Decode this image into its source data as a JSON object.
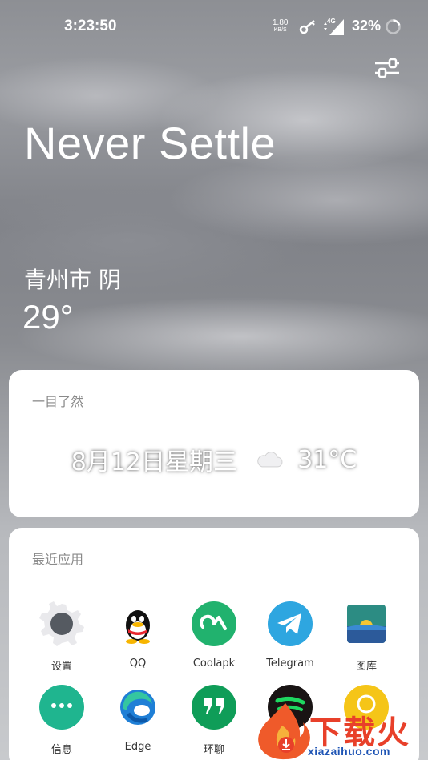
{
  "status_bar": {
    "time": "3:23:50",
    "net_speed_value": "1.80",
    "net_speed_unit": "KB/S",
    "network_type": "4G",
    "battery_percent": "32%"
  },
  "header": {
    "headline": "Never Settle"
  },
  "weather": {
    "city_condition": "青州市  阴",
    "temperature": "29°"
  },
  "glance_card": {
    "title": "一目了然",
    "date": "8月12日星期三",
    "forecast_temp": "31°C"
  },
  "recent_apps_card": {
    "title": "最近应用",
    "apps": [
      {
        "label": "设置",
        "icon": "settings-gear-icon"
      },
      {
        "label": "QQ",
        "icon": "qq-penguin-icon"
      },
      {
        "label": "Coolapk",
        "icon": "coolapk-icon"
      },
      {
        "label": "Telegram",
        "icon": "telegram-icon"
      },
      {
        "label": "图库",
        "icon": "gallery-icon"
      },
      {
        "label": "信息",
        "icon": "messages-icon"
      },
      {
        "label": "Edge",
        "icon": "edge-icon"
      },
      {
        "label": "环聊",
        "icon": "hangouts-icon"
      },
      {
        "label": "",
        "icon": "spotify-icon"
      },
      {
        "label": "",
        "icon": "yellow-app-icon"
      }
    ]
  },
  "watermark": {
    "brand": "下载火",
    "url": "xiazaihuo.com"
  },
  "colors": {
    "accent_green": "#21b26e",
    "telegram_blue": "#2ea6e0",
    "watermark_red": "#e8402a"
  }
}
